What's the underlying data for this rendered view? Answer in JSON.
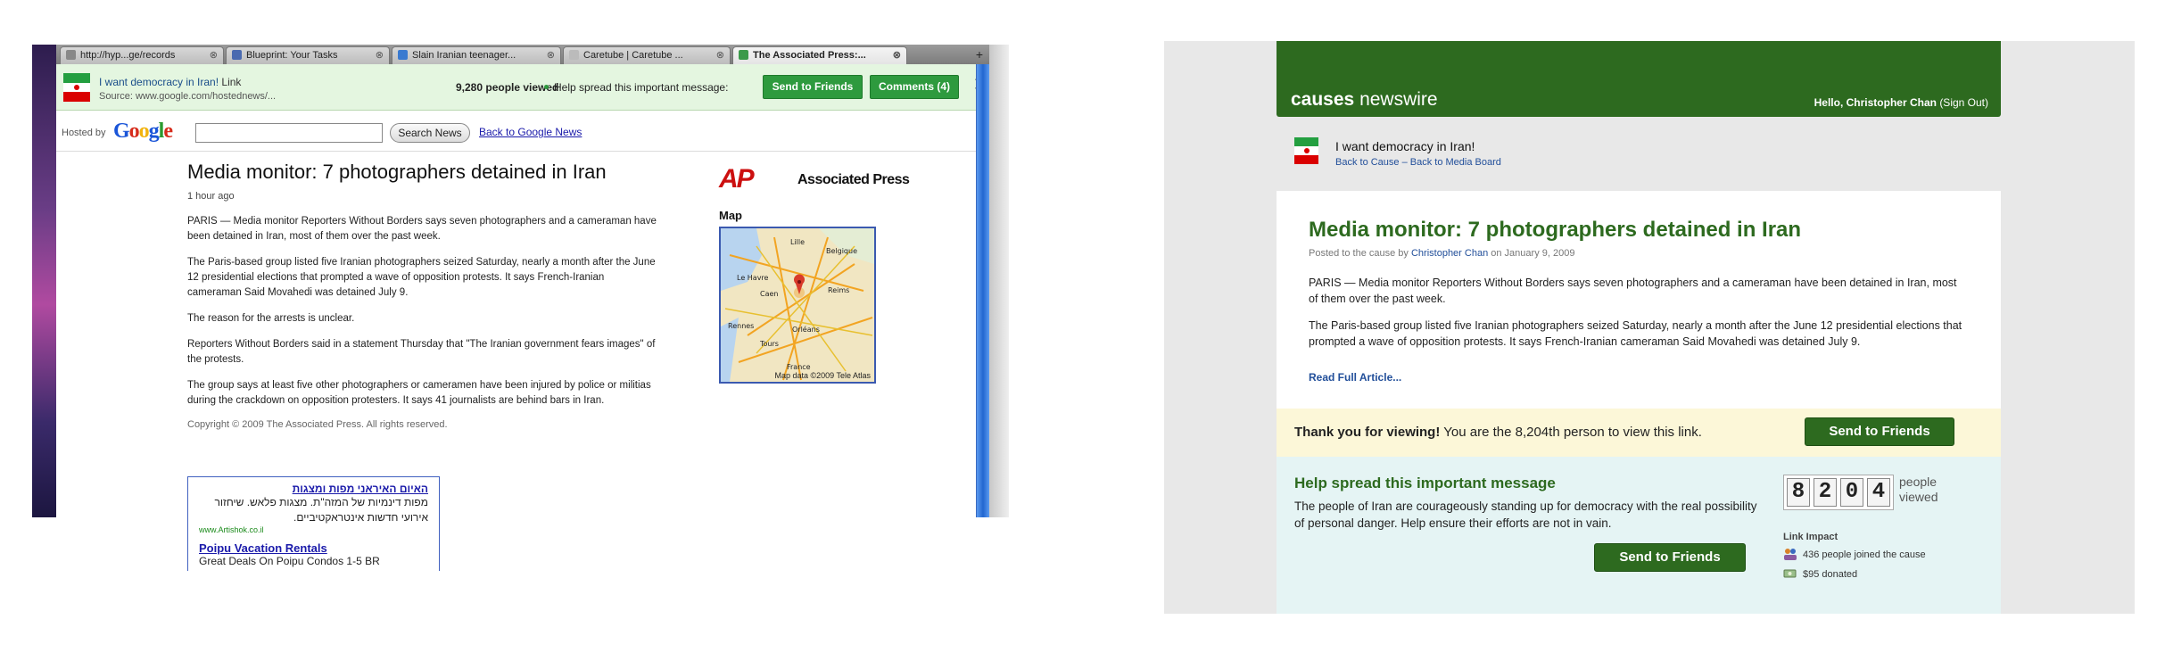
{
  "browser": {
    "tabs": [
      {
        "label": "http://hyp...ge/records"
      },
      {
        "label": "Blueprint: Your Tasks"
      },
      {
        "label": "Slain Iranian teenager..."
      },
      {
        "label": "Caretube | Caretube ..."
      },
      {
        "label": "The Associated Press:..."
      }
    ],
    "new_tab": "+",
    "menu": "≡",
    "close_symbol": "⊗"
  },
  "causebar": {
    "title": "I want democracy in Iran!",
    "link_label": "Link",
    "source": "Source: www.google.com/hostednews/...",
    "views": "9,280 people viewed",
    "help": "Help spread this important message:",
    "send_btn": "Send to Friends",
    "comments_btn": "Comments (4)",
    "close": "✕"
  },
  "googlebar": {
    "hosted_by": "Hosted by",
    "logo": "Google",
    "search_btn": "Search News",
    "back_link": "Back to Google News"
  },
  "article": {
    "title": "Media monitor: 7 photographers detained in Iran",
    "time": "1 hour ago",
    "paragraphs": [
      "PARIS — Media monitor Reporters Without Borders says seven photographers and a cameraman have been detained in Iran, most of them over the past week.",
      "The Paris-based group listed five Iranian photographers seized Saturday, nearly a month after the June 12 presidential elections that prompted a wave of opposition protests. It says French-Iranian cameraman Said Movahedi was detained July 9.",
      "The reason for the arrests is unclear.",
      "Reporters Without Borders said in a statement Thursday that \"The Iranian government fears images\" of the protests.",
      "The group says at least five other photographers or cameramen have been injured by police or militias during the crackdown on opposition protesters. It says 41 journalists are behind bars in Iran."
    ],
    "copyright": "Copyright © 2009 The Associated Press. All rights reserved."
  },
  "sidebar": {
    "ap_logo": "AP",
    "ap_name": "Associated Press",
    "map_label": "Map",
    "map_credit": "Map data ©2009 Tele Atlas",
    "map_places": [
      "Lille",
      "Belgique",
      "Le Havre",
      "Reims",
      "Caen",
      "Rennes",
      "Tours",
      "Orléans",
      "France"
    ]
  },
  "ad": {
    "title1": "האיום האיראני מפות ומצגות",
    "text1": "מפות דינמיות של המזה\"ת. מצגות פלאש. שיחזור אירועי חדשות אינטראקטיביים.",
    "url1": "www.Artishok.co.il",
    "title2": "Poipu Vacation Rentals",
    "text2": "Great Deals On Poipu Condos 1-5 BR"
  },
  "newswire": {
    "logo_bold": "causes",
    "logo_light": "newswire",
    "hello": "Hello, Christopher Chan",
    "signout": "(Sign Out)",
    "cause_name": "I want democracy in Iran!",
    "cause_links": "Back to Cause – Back to Media Board",
    "title": "Media monitor: 7 photographers detained in Iran",
    "posted_prefix": "Posted to the cause by",
    "posted_author": "Christopher Chan",
    "posted_date": "on January 9, 2009",
    "paragraphs": [
      "PARIS — Media monitor Reporters Without Borders says seven photographers and a cameraman have been detained in Iran, most of them over the past week.",
      "The Paris-based group listed five Iranian photographers seized Saturday, nearly a month after the June 12 presidential elections that prompted a wave of opposition protests. It says French-Iranian cameraman Said Movahedi was detained July 9."
    ],
    "read_more": "Read Full Article...",
    "thanks_bold": "Thank you for viewing!",
    "thanks_text": "You are the 8,204th person to view this link.",
    "send_btn": "Send to Friends",
    "help_title": "Help spread this important message",
    "help_text": "The people of Iran are courageously standing up for democracy with the real possibility of personal danger. Help ensure their efforts are not in vain.",
    "counter_digits": [
      "8",
      "2",
      "0",
      "4"
    ],
    "counter_label": "people viewed",
    "impact_label": "Link Impact",
    "impact_joined": "436 people joined the cause",
    "impact_donated": "$95 donated"
  },
  "colors": {
    "causes_green": "#2d6a1f",
    "bar_green": "#2e9a3e",
    "link_blue": "#224f9a",
    "thanks_bg": "#fcf7d8",
    "help_bg": "#e5f4f4",
    "ap_red": "#cc1010"
  }
}
